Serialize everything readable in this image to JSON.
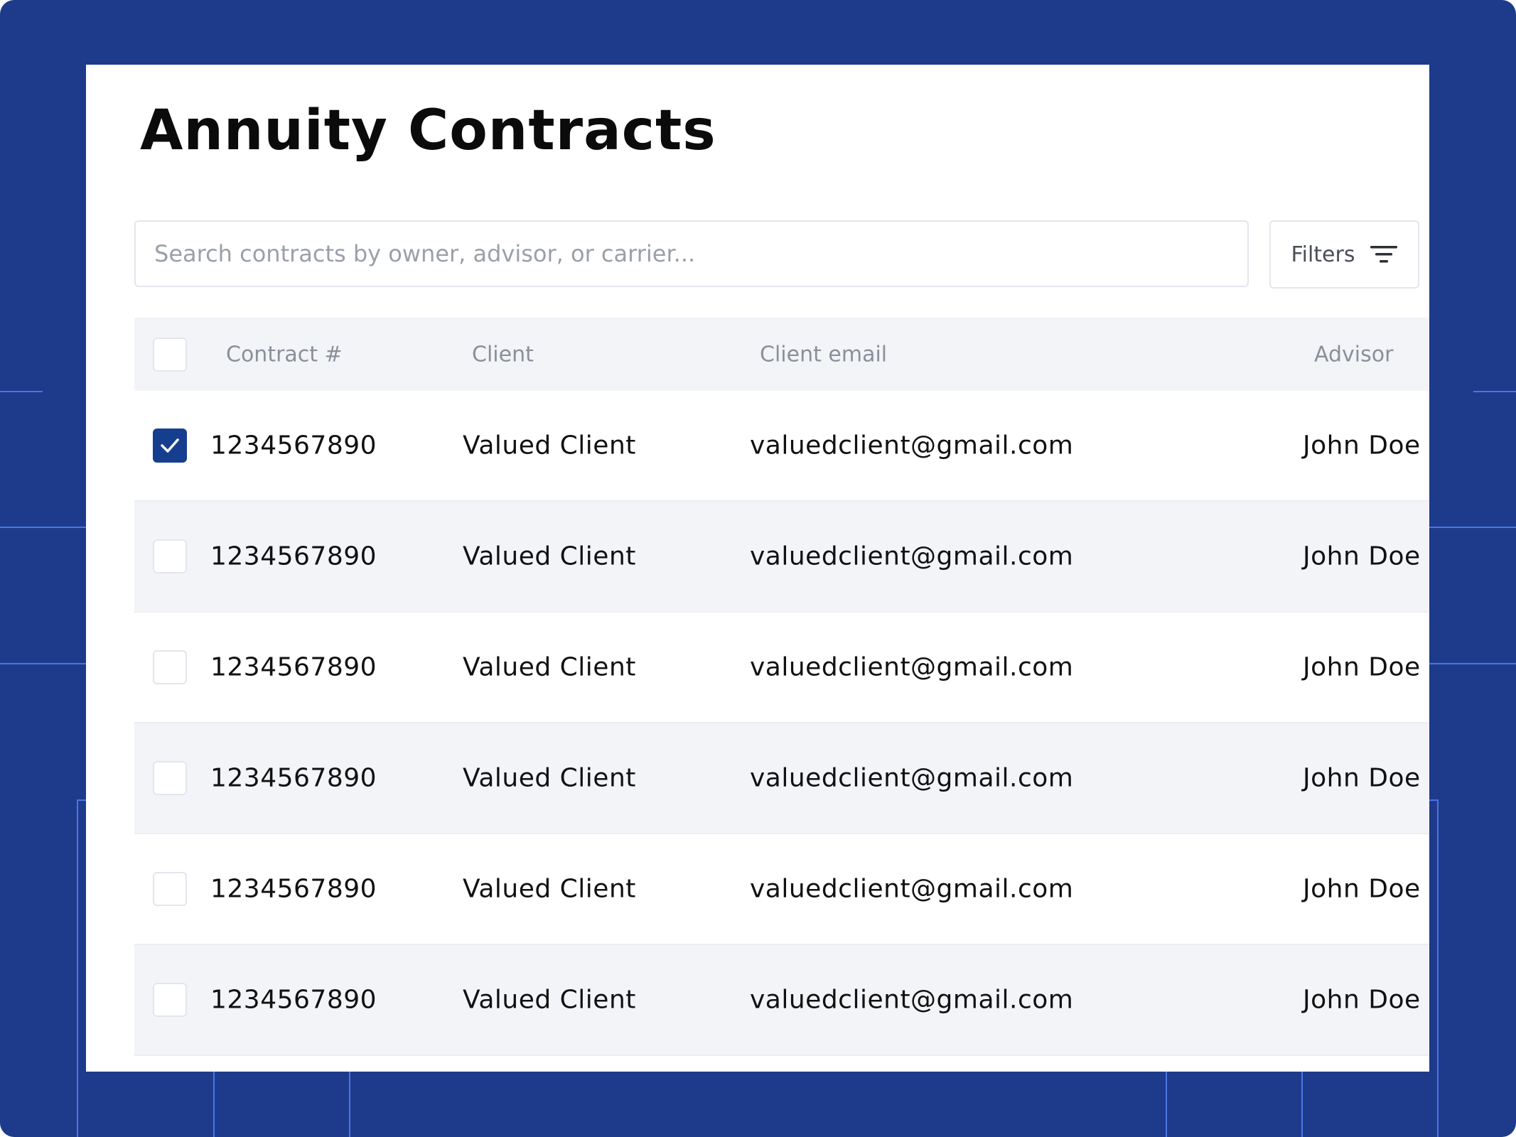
{
  "page": {
    "title": "Annuity Contracts"
  },
  "search": {
    "placeholder": "Search contracts by owner, advisor, or carrier...",
    "value": ""
  },
  "filters": {
    "label": "Filters",
    "icon": "filter-lines-icon"
  },
  "table": {
    "columns": [
      "Contract #",
      "Client",
      "Client email",
      "Advisor"
    ],
    "rows": [
      {
        "checked": true,
        "contract": "1234567890",
        "client": "Valued Client",
        "email": "valuedclient@gmail.com",
        "advisor": "John Doe"
      },
      {
        "checked": false,
        "contract": "1234567890",
        "client": "Valued Client",
        "email": "valuedclient@gmail.com",
        "advisor": "John Doe"
      },
      {
        "checked": false,
        "contract": "1234567890",
        "client": "Valued Client",
        "email": "valuedclient@gmail.com",
        "advisor": "John Doe"
      },
      {
        "checked": false,
        "contract": "1234567890",
        "client": "Valued Client",
        "email": "valuedclient@gmail.com",
        "advisor": "John Doe"
      },
      {
        "checked": false,
        "contract": "1234567890",
        "client": "Valued Client",
        "email": "valuedclient@gmail.com",
        "advisor": "John Doe"
      },
      {
        "checked": false,
        "contract": "1234567890",
        "client": "Valued Client",
        "email": "valuedclient@gmail.com",
        "advisor": "John Doe"
      }
    ]
  },
  "colors": {
    "background": "#1e3a8a",
    "accent": "#163e8f",
    "row_alt": "#f3f4f8"
  }
}
